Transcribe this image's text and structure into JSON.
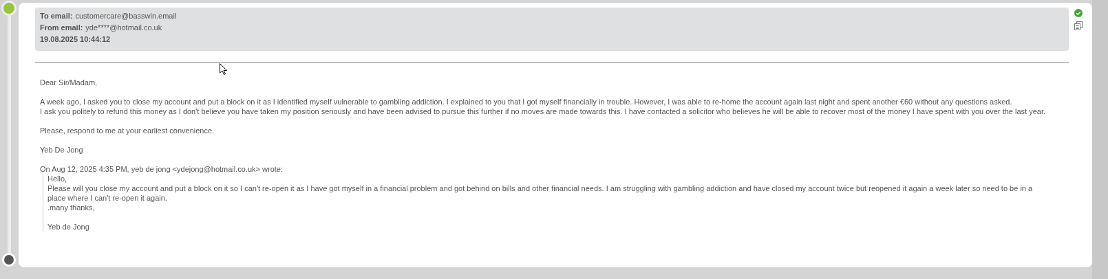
{
  "header": {
    "fields": [
      {
        "label": "To email:",
        "value": "customercare@basswin.email"
      },
      {
        "label": "From email:",
        "value": "yde****@hotmail.co.uk"
      }
    ],
    "date": "19.08.2025 10:44:12",
    "confirmed": true
  },
  "body": [
    {
      "lines": [
        "Dear Sir/Madam,"
      ]
    },
    {
      "lines": [
        "A week ago, I asked you to close my account and put a block on it as I identified myself vulnerable to gambling addiction. I explained to you that I got myself financially in trouble. However, I was able to re-home the account again last night and spent another €60 without any questions asked.",
        "I ask you politely to refund this money as I don't believe you have taken my position seriously and have been advised to pursue this further if no moves are made towards this. I have contacted a solicitor who believes he will be able to recover most of the money I have spent with you over the last year."
      ]
    },
    {
      "lines": [
        "Please, respond to me at your earliest convenience."
      ]
    },
    {
      "lines": [
        "Yeb De Jong"
      ]
    }
  ],
  "quote": {
    "intro": "On Aug 12, 2025 4:35 PM, yeb de jong <ydejong@hotmail.co.uk> wrote:",
    "blocks": [
      {
        "lines": [
          "Hello,",
          "Please will you close my account and put a block on it so I can't re-open it as I have got myself in a financial problem and got behind on bills and other financial needs. I am struggling with gambling addiction and have closed my account twice but reopened it again a week later so need to be in a",
          "place where I can't re-open it again.",
          ".many thanks,"
        ]
      },
      {
        "lines": [
          "Yeb de Jong"
        ]
      }
    ]
  }
}
